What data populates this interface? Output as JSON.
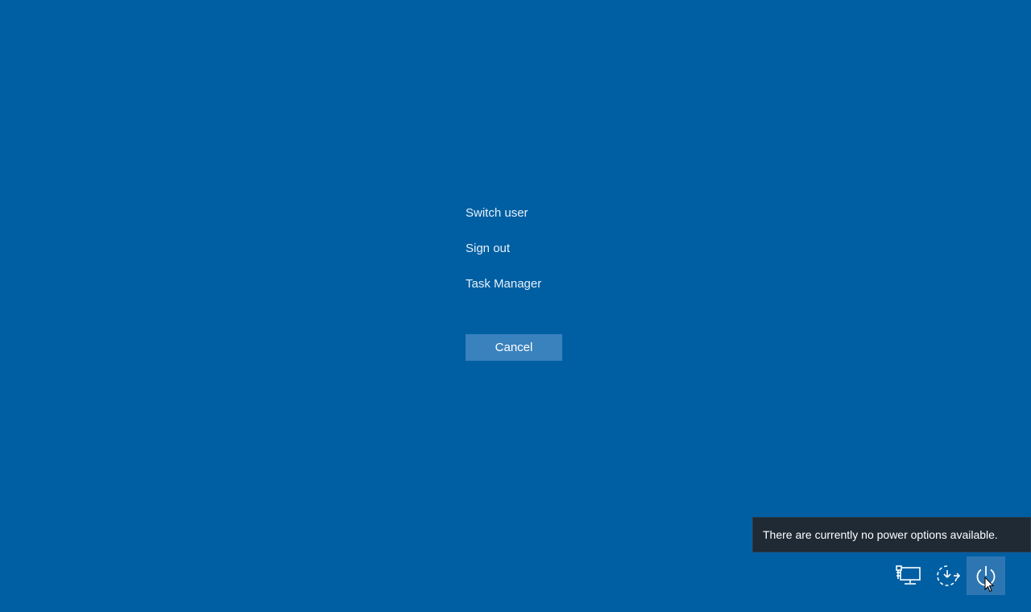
{
  "menu": {
    "items": [
      {
        "label": "Switch user"
      },
      {
        "label": "Sign out"
      },
      {
        "label": "Task Manager"
      }
    ],
    "cancel_label": "Cancel"
  },
  "tooltip": {
    "text": "There are currently no power options available."
  },
  "tray": {
    "icons": [
      "network-icon",
      "ease-of-access-icon",
      "power-icon"
    ]
  },
  "colors": {
    "background": "#005fa3",
    "button": "#3a82bd",
    "tooltip_bg": "#1f2a35",
    "hover": "#2e76b2"
  }
}
